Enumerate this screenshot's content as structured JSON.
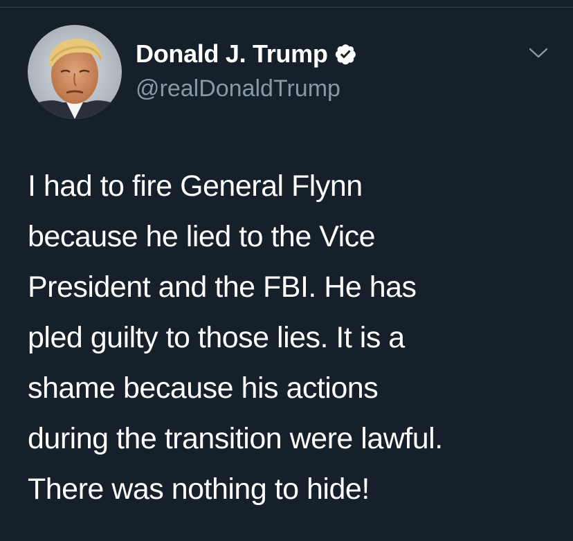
{
  "tweet": {
    "author": {
      "display_name": "Donald J. Trump",
      "handle": "@realDonaldTrump",
      "verified": true
    },
    "menu_icon": "chevron-down-icon",
    "text_lines": [
      "I had to fire General Flynn",
      "because he lied to the Vice",
      "President and the FBI. He has",
      "pled guilty to those lies. It is a",
      "shame because his actions",
      "during the transition were lawful.",
      "There was nothing to hide!"
    ]
  },
  "colors": {
    "background": "#15202b",
    "text_primary": "#ffffff",
    "text_secondary": "#8899a6",
    "verified_badge": "#ffffff",
    "divider": "#38444d"
  }
}
